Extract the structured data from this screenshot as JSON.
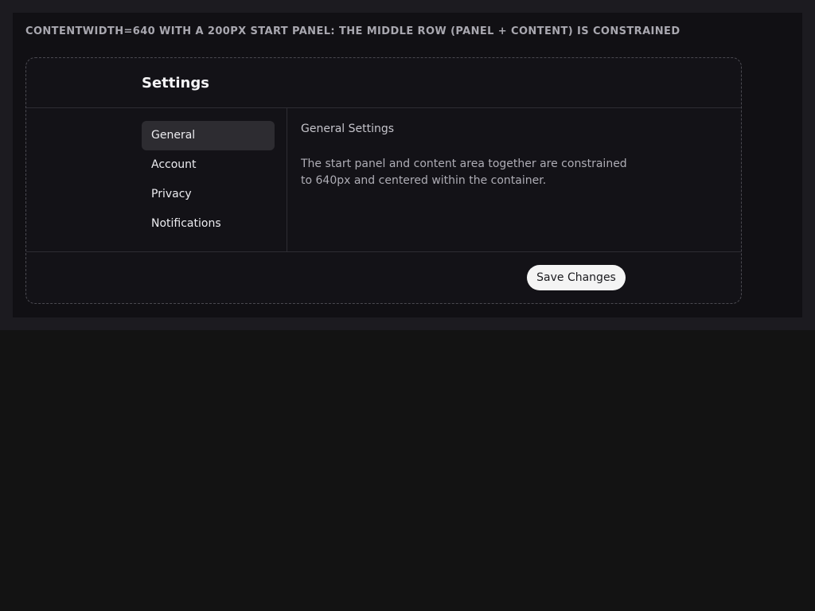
{
  "caption": "CONTENTWIDTH=640 WITH A 200PX START PANEL: THE MIDDLE ROW (PANEL + CONTENT) IS CONSTRAINED",
  "header": {
    "title": "Settings"
  },
  "sidebar": {
    "items": [
      {
        "label": "General",
        "active": true
      },
      {
        "label": "Account",
        "active": false
      },
      {
        "label": "Privacy",
        "active": false
      },
      {
        "label": "Notifications",
        "active": false
      }
    ]
  },
  "main": {
    "title": "General Settings",
    "body": "The start panel and content area together are constrained to 640px and centered within the container."
  },
  "footer": {
    "save_label": "Save Changes"
  }
}
